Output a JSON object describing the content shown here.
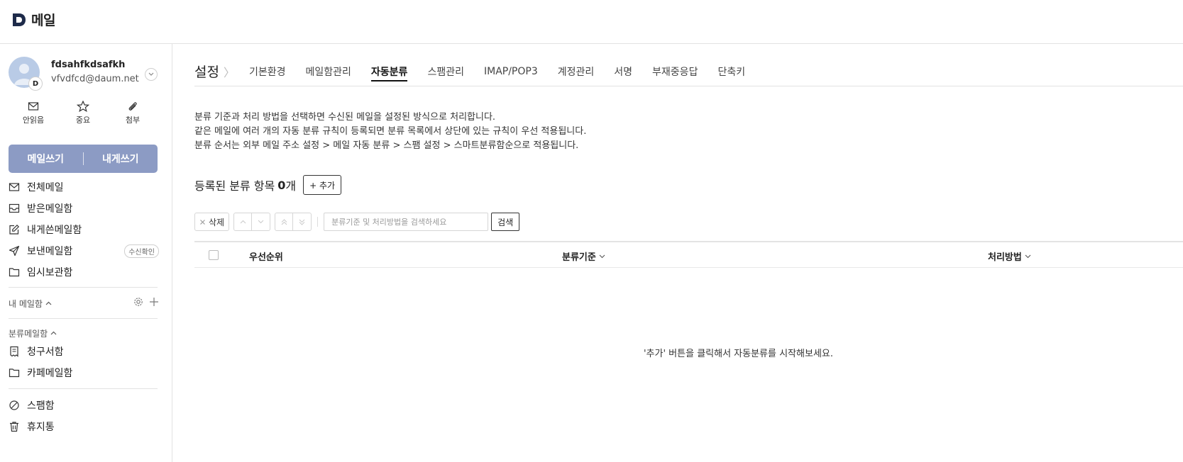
{
  "header": {
    "logo_text": "메일"
  },
  "profile": {
    "name": "fdsahfkdsafkh",
    "email": "vfvdfcd@daum.net",
    "badge": "D"
  },
  "quick_actions": [
    {
      "label": "안읽음",
      "icon": "envelope-icon"
    },
    {
      "label": "중요",
      "icon": "star-icon"
    },
    {
      "label": "첨부",
      "icon": "paperclip-icon"
    }
  ],
  "compose": {
    "write_label": "메일쓰기",
    "self_label": "내게쓰기"
  },
  "mailboxes": [
    {
      "label": "전체메일",
      "icon": "envelope-icon"
    },
    {
      "label": "받은메일함",
      "icon": "inbox-icon"
    },
    {
      "label": "내게쓴메일함",
      "icon": "edit-icon"
    },
    {
      "label": "보낸메일함",
      "icon": "send-icon",
      "badge": "수신확인"
    },
    {
      "label": "임시보관함",
      "icon": "folder-icon"
    }
  ],
  "my_mailbox_section": {
    "label": "내 메일함"
  },
  "category_section": {
    "label": "분류메일함",
    "items": [
      {
        "label": "청구서함",
        "icon": "receipt-icon"
      },
      {
        "label": "카페메일함",
        "icon": "folder-icon"
      }
    ]
  },
  "bottom_boxes": [
    {
      "label": "스팸함",
      "icon": "block-icon"
    },
    {
      "label": "휴지통",
      "icon": "trash-icon"
    }
  ],
  "settings": {
    "title": "설정",
    "tabs": [
      "기본환경",
      "메일함관리",
      "자동분류",
      "스팸관리",
      "IMAP/POP3",
      "계정관리",
      "서명",
      "부재중응답",
      "단축키"
    ],
    "active_tab": "자동분류"
  },
  "description": [
    "분류 기준과 처리 방법을 선택하면 수신된 메일을 설정된 방식으로 처리합니다.",
    "같은 메일에 여러 개의 자동 분류 규칙이 등록되면 분류 목록에서 상단에 있는 규칙이 우선 적용됩니다.",
    "분류 순서는 외부 메일 주소 설정 > 메일 자동 분류 > 스팸 설정 > 스마트분류함순으로 적용됩니다."
  ],
  "registered": {
    "label": "등록된 분류 항목",
    "count": "0",
    "unit": "개",
    "add_label": "+ 추가"
  },
  "toolbar": {
    "delete_label": "삭제",
    "search_placeholder": "분류기준 및 처리방법을 검색하세요",
    "search_label": "검색"
  },
  "table": {
    "columns": [
      "우선순위",
      "분류기준",
      "처리방법"
    ]
  },
  "empty_message": "'추가' 버튼을 클릭해서 자동분류를 시작해보세요."
}
